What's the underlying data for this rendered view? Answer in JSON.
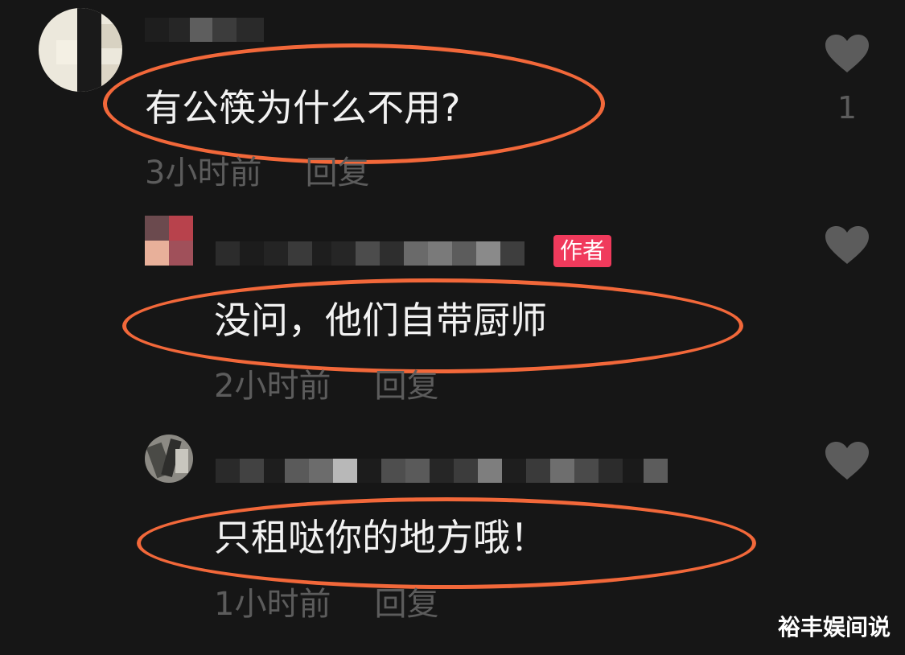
{
  "comments": [
    {
      "text": "有公筷为什么不用?",
      "time": "3小时前",
      "reply_label": "回复",
      "like_count": "1",
      "is_author": false
    },
    {
      "text": "没问，他们自带厨师",
      "time": "2小时前",
      "reply_label": "回复",
      "like_count": "",
      "is_author": true,
      "author_badge": "作者"
    },
    {
      "text": "只租哒你的地方哦！",
      "time": "1小时前",
      "reply_label": "回复",
      "like_count": "",
      "is_author": false
    }
  ],
  "icons": {
    "like": "heart-icon"
  },
  "colors": {
    "background": "#161616",
    "highlight_outline": "#f2683a",
    "author_badge": "#f03a5c",
    "meta_text": "#5c5c5c",
    "heart": "#5c5c5c"
  },
  "watermark": "裕丰娱间说"
}
